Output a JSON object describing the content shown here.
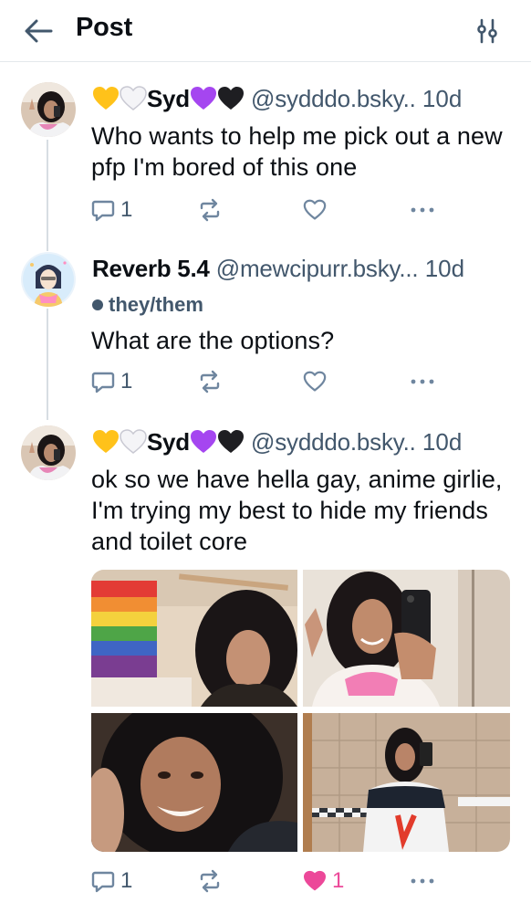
{
  "header": {
    "title": "Post",
    "back_icon": "arrow-left-icon",
    "settings_icon": "sliders-icon"
  },
  "colors": {
    "text_primary": "#0b0f14",
    "text_secondary": "#42576c",
    "icon_muted": "#6f869f",
    "like_pink": "#ec4899",
    "divider": "#e4e8ec"
  },
  "posts": [
    {
      "display_name": "Syd",
      "name_emoji_before": [
        "yellow-heart",
        "white-heart"
      ],
      "name_emoji_after": [
        "purple-heart",
        "black-heart"
      ],
      "handle": "@sydddo.bsky..",
      "time": "10d",
      "text": "Who wants to help me pick out a new pfp I'm bored of this one",
      "reply_count": "1",
      "like_count": "",
      "liked": false
    },
    {
      "display_name": "Reverb 5.4",
      "handle": "@mewcipurr.bsky...",
      "time": "10d",
      "pronouns": "they/them",
      "text": "What are the options?",
      "reply_count": "1",
      "like_count": "",
      "liked": false
    },
    {
      "display_name": "Syd",
      "name_emoji_before": [
        "yellow-heart",
        "white-heart"
      ],
      "name_emoji_after": [
        "purple-heart",
        "black-heart"
      ],
      "handle": "@sydddo.bsky..",
      "time": "10d",
      "text": "ok so we have hella gay, anime girlie, I'm trying my best to hide my friends and toilet core",
      "reply_count": "1",
      "like_count": "1",
      "liked": true,
      "images": [
        "photo-pride-flag",
        "photo-smiling-hoodie",
        "photo-close-up",
        "photo-bathroom-mirror"
      ]
    }
  ]
}
